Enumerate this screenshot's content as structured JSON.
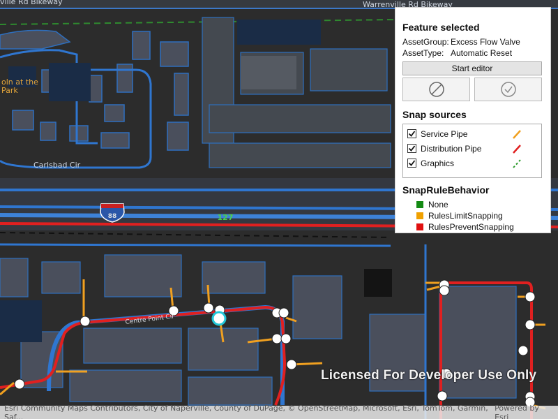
{
  "map": {
    "labels": {
      "top_road": "Warrenville Rd Bikeway",
      "top_left_road": "ville Rd Bikeway",
      "park": "oln at the Park",
      "park_line1": "oln at the",
      "park_line2": "Park",
      "street": "Carlsbad Cir",
      "street2": "Centre Point Cir",
      "interstate": "88",
      "mile_marker": "127"
    }
  },
  "panel": {
    "feature_title": "Feature selected",
    "asset_group_key": "AssetGroup:",
    "asset_group_value": "Excess Flow Valve",
    "asset_type_key": "AssetType:",
    "asset_type_value": "Automatic Reset",
    "start_editor_label": "Start editor",
    "cancel_icon": "cancel-icon",
    "confirm_icon": "check-icon",
    "snap_title": "Snap sources",
    "snap_sources": [
      {
        "label": "Service Pipe",
        "checked": true,
        "color": "#f0a020"
      },
      {
        "label": "Distribution Pipe",
        "checked": true,
        "color": "#e02020"
      },
      {
        "label": "Graphics",
        "checked": true,
        "color": "#2a9a2a"
      }
    ],
    "rule_title": "SnapRuleBehavior",
    "rules": [
      {
        "label": "None",
        "color": "#138a13"
      },
      {
        "label": "RulesLimitSnapping",
        "color": "#f0a000"
      },
      {
        "label": "RulesPreventSnapping",
        "color": "#e01010"
      }
    ]
  },
  "watermark": "Licensed For Developer Use Only",
  "attribution": {
    "left": "Esri Community Maps Contributors, City of Naperville, County of DuPage, © OpenStreetMap, Microsoft, Esri, TomTom, Garmin, Saf...",
    "right": "Powered by Esri"
  }
}
